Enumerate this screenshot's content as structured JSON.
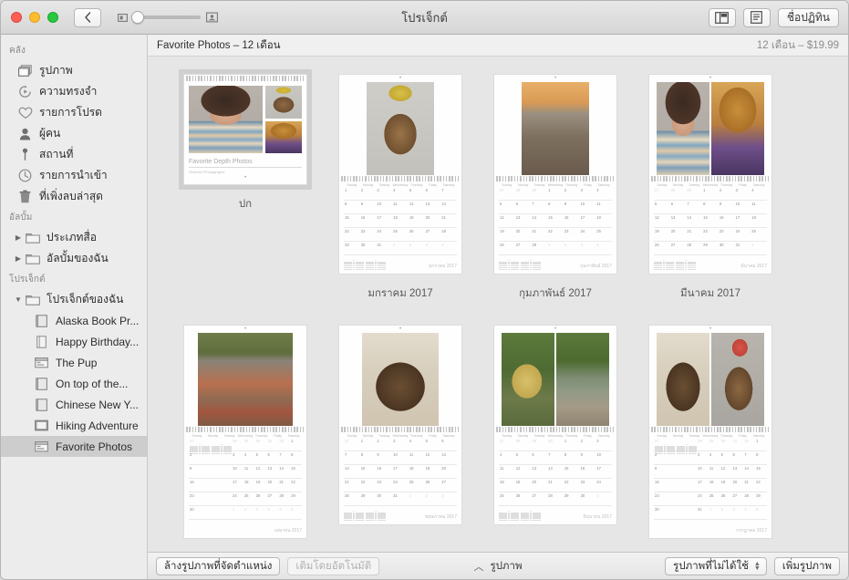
{
  "window": {
    "title": "โปรเจ็กต์",
    "back_label": "back-chevron",
    "traffic_lights": [
      "close",
      "minimize",
      "maximize"
    ]
  },
  "toolbar": {
    "zoom_small_icon": "small-thumbnail-icon",
    "zoom_large_icon": "large-thumbnail-icon",
    "zoom_value": 0,
    "sidebar_toggle_label": "layout-panel-icon",
    "info_label": "info-list-icon",
    "calendar_name_label": "ชื่อปฏิทิน"
  },
  "sidebar": {
    "sections": [
      {
        "header": "คลัง",
        "items": [
          {
            "label": "รูปภาพ",
            "icon": "photos-icon",
            "name": "sidebar-item-photos"
          },
          {
            "label": "ความทรงจำ",
            "icon": "memories-icon",
            "name": "sidebar-item-memories"
          },
          {
            "label": "รายการโปรด",
            "icon": "heart-icon",
            "name": "sidebar-item-favorites"
          },
          {
            "label": "ผู้คน",
            "icon": "people-icon",
            "name": "sidebar-item-people"
          },
          {
            "label": "สถานที่",
            "icon": "pin-icon",
            "name": "sidebar-item-places"
          },
          {
            "label": "รายการนำเข้า",
            "icon": "clock-icon",
            "name": "sidebar-item-imports"
          },
          {
            "label": "ที่เพิ่งลบล่าสุด",
            "icon": "trash-icon",
            "name": "sidebar-item-recently-deleted"
          }
        ]
      },
      {
        "header": "อัลบั้ม",
        "items": [
          {
            "label": "ประเภทสื่อ",
            "icon": "folder-icon",
            "disclosure": "collapsed",
            "name": "sidebar-item-media-types"
          },
          {
            "label": "อัลบั้มของฉัน",
            "icon": "folder-icon",
            "disclosure": "collapsed",
            "name": "sidebar-item-my-albums"
          }
        ]
      },
      {
        "header": "โปรเจ็กต์",
        "items": [
          {
            "label": "โปรเจ็กต์ของฉัน",
            "icon": "folder-icon",
            "disclosure": "expanded",
            "name": "sidebar-item-my-projects"
          },
          {
            "label": "Alaska Book Pr...",
            "icon": "book-icon",
            "indent": 3,
            "name": "sidebar-item-alaska-book"
          },
          {
            "label": "Happy Birthday...",
            "icon": "card-icon",
            "indent": 3,
            "name": "sidebar-item-happy-birthday"
          },
          {
            "label": "The Pup",
            "icon": "calendar-icon",
            "indent": 3,
            "name": "sidebar-item-the-pup"
          },
          {
            "label": "On top of the...",
            "icon": "book-icon",
            "indent": 3,
            "name": "sidebar-item-on-top-of-the"
          },
          {
            "label": "Chinese New Y...",
            "icon": "book-icon",
            "indent": 3,
            "name": "sidebar-item-chinese-new-year"
          },
          {
            "label": "Hiking Adventure",
            "icon": "slideshow-icon",
            "indent": 3,
            "name": "sidebar-item-hiking-adventure"
          },
          {
            "label": "Favorite Photos",
            "icon": "calendar-icon",
            "indent": 3,
            "selected": true,
            "name": "sidebar-item-favorite-photos"
          }
        ]
      }
    ]
  },
  "main": {
    "header_title": "Favorite Photos – 12 เดือน",
    "header_price": "12 เดือน – $19.99"
  },
  "project": {
    "pages": [
      {
        "kind": "cover",
        "caption": "ปก",
        "selected": true,
        "cover_title": "Favorite Depth Photos",
        "cover_subtitle": "Selected Photographs",
        "photos": [
          "curly-portrait",
          "dog-with-crown",
          "blonde-sunset-portrait"
        ]
      },
      {
        "kind": "month",
        "caption": "มกราคม 2017",
        "month_footer": "มกราคม 2017",
        "photos": [
          "dog-king-crown"
        ],
        "layout": "single",
        "first_weekday": 0,
        "days": 31,
        "trailing_dim": 4,
        "leading_dim": 0,
        "mini_position": "bottom"
      },
      {
        "kind": "month",
        "caption": "กุมภาพันธ์ 2017",
        "month_footer": "กุมภาพันธ์ 2017",
        "photos": [
          "dog-on-pier"
        ],
        "layout": "single",
        "first_weekday": 3,
        "days": 28,
        "trailing_dim": 4,
        "leading_dim": 3,
        "mini_position": "bottom"
      },
      {
        "kind": "month",
        "caption": "มีนาคม 2017",
        "month_footer": "มีนาคม 2017",
        "photos": [
          "curly-portrait",
          "blonde-sunset-portrait"
        ],
        "layout": "wide",
        "first_weekday": 3,
        "days": 31,
        "trailing_dim": 1,
        "leading_dim": 3,
        "mini_position": "bottom"
      },
      {
        "kind": "month",
        "caption": "",
        "month_footer": "เมษายน 2017",
        "photos": [
          "dog-on-mat"
        ],
        "layout": "single",
        "first_weekday": 6,
        "days": 30,
        "trailing_dim": 2,
        "leading_dim": 6,
        "mini_position": "top"
      },
      {
        "kind": "month",
        "caption": "",
        "month_footer": "พฤษภาคม 2017",
        "photos": [
          "dog-in-hood"
        ],
        "layout": "single",
        "first_weekday": 1,
        "days": 31,
        "trailing_dim": 3,
        "leading_dim": 1,
        "mini_position": "bottom"
      },
      {
        "kind": "month",
        "caption": "",
        "month_footer": "มิถุนายน 2017",
        "photos": [
          "girl-in-hammock",
          "dog-by-water"
        ],
        "layout": "wide",
        "first_weekday": 4,
        "days": 30,
        "trailing_dim": 1,
        "leading_dim": 4,
        "mini_position": "bottom"
      },
      {
        "kind": "month",
        "caption": "",
        "month_footer": "กรกฎาคม 2017",
        "photos": [
          "dog-in-hood",
          "dog-party-hat"
        ],
        "layout": "wide",
        "first_weekday": 6,
        "days": 31,
        "trailing_dim": 1,
        "leading_dim": 6,
        "mini_position": "top"
      }
    ],
    "day_headers": [
      "Sunday",
      "Monday",
      "Tuesday",
      "Wednesday",
      "Thursday",
      "Friday",
      "Saturday"
    ]
  },
  "bottombar": {
    "clear_label": "ล้างรูปภาพที่จัดตำแหน่ง",
    "autofill_label": "เติมโดยอัตโนมัติ",
    "center_label": "รูปภาพ",
    "chevron": "chevron-up-icon",
    "filter_label": "รูปภาพที่ไม่ได้ใช้",
    "add_photos_label": "เพิ่มรูปภาพ"
  },
  "colors": {
    "window_bg": "#ececec",
    "canvas_bg": "#e6e6e6",
    "selection": "#cdcdcd",
    "page_white": "#fefefe",
    "text_primary": "#2d2d2d",
    "text_muted": "#8a8a8a"
  }
}
